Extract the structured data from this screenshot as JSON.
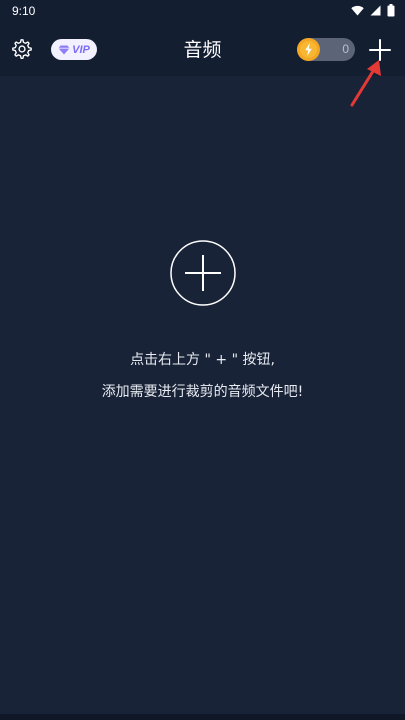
{
  "status_bar": {
    "time": "9:10"
  },
  "header": {
    "title": "音频",
    "vip_label": "VIP",
    "coin_count": "0",
    "icons": {
      "settings": "gear-icon",
      "vip": "diamond-icon",
      "coin": "lightning-coin-icon",
      "add": "plus-icon"
    }
  },
  "empty_state": {
    "line1": "点击右上方 \" + \" 按钮,",
    "line2": "添加需要进行裁剪的音频文件吧!",
    "icon": "circle-plus-icon"
  },
  "colors": {
    "background": "#182337",
    "header": "#141e31",
    "vip_bg": "#f3f0ff",
    "vip_text": "#7b6cf6",
    "coin": "#f5a623",
    "annotation_arrow": "#e53935"
  }
}
